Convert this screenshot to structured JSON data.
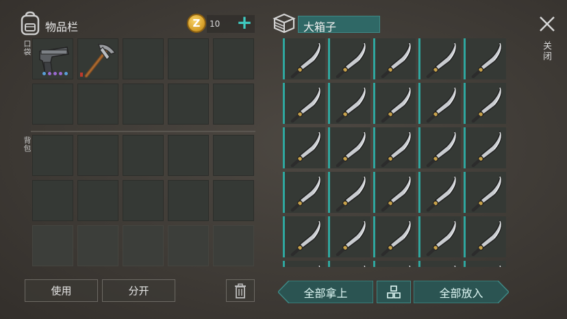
{
  "inventory": {
    "title": "物品栏",
    "pocket_label": "口袋",
    "backpack_label": "背包",
    "coins": "10",
    "add_symbol": "+",
    "coin_symbol": "Z",
    "pocket_items": [
      "pistol",
      "pickaxe",
      "",
      "",
      "",
      "",
      "",
      "",
      "",
      ""
    ],
    "pistol_quality_dots": [
      "#5aa0d8",
      "#9a6ad0",
      "#9a6ad0",
      "#9a6ad0",
      "#5aa0d8"
    ]
  },
  "chest": {
    "title": "大箱子",
    "item_name": "machete",
    "rows_visible": 6,
    "columns": 5
  },
  "close": {
    "label": "关闭"
  },
  "actions": {
    "use": "使用",
    "split": "分开",
    "take_all": "全部拿上",
    "put_all": "全部放入"
  },
  "icons": {
    "backpack": "backpack-icon",
    "box": "box-icon",
    "trash": "trash-icon",
    "sort": "sort-grid-icon",
    "close": "close-icon",
    "coin": "coin-icon"
  },
  "colors": {
    "accent": "#2fa79f",
    "teal_button": "#2f6866",
    "coin": "#d9a32c"
  }
}
